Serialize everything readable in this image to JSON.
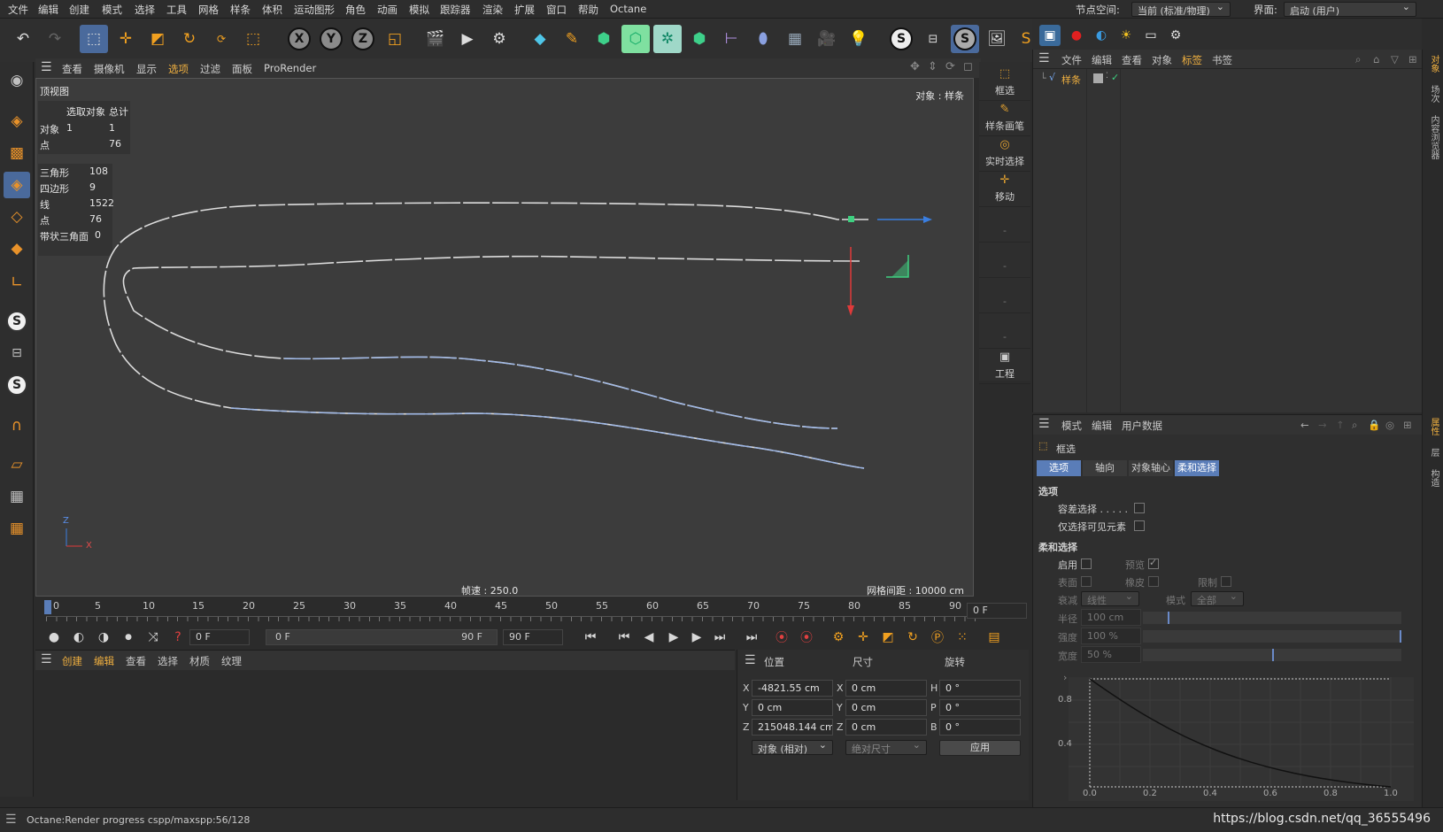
{
  "menu": [
    "文件",
    "编辑",
    "创建",
    "模式",
    "选择",
    "工具",
    "网格",
    "样条",
    "体积",
    "运动图形",
    "角色",
    "动画",
    "模拟",
    "跟踪器",
    "渲染",
    "扩展",
    "窗口",
    "帮助",
    "Octane"
  ],
  "node_space_label": "节点空间:",
  "node_space_value": "当前 (标准/物理)",
  "interface_label": "界面:",
  "interface_value": "启动 (用户)",
  "toolbar": {
    "undo": "undo-icon",
    "redo": "redo-icon",
    "x": "X",
    "y": "Y",
    "z": "Z",
    "s": "S"
  },
  "viewport_menu": [
    "查看",
    "摄像机",
    "显示",
    "选项",
    "过滤",
    "面板",
    "ProRender"
  ],
  "viewport": {
    "name": "顶视图",
    "object_label": "对象 : 样条",
    "frame_rate": "帧速 : 250.0",
    "grid_spacing": "网格间距 : 10000 cm",
    "axis_z": "Z",
    "axis_x": "X",
    "stats_header_sel": "选取对象",
    "stats_header_total": "总计",
    "stats": [
      {
        "label": "对象",
        "sel": "1",
        "total": "1"
      },
      {
        "label": "点",
        "sel": "",
        "total": "76"
      }
    ],
    "stats2": [
      {
        "label": "三角形",
        "value": "108"
      },
      {
        "label": "四边形",
        "value": "9"
      },
      {
        "label": "线",
        "value": "1522"
      },
      {
        "label": "点",
        "value": "76"
      },
      {
        "label": "带状三角面",
        "value": "0"
      }
    ]
  },
  "right_viewport_tools": [
    "框选",
    "样条画笔",
    "实时选择",
    "移动",
    "-",
    "-",
    "-",
    "-",
    "工程"
  ],
  "timeline": {
    "ticks": [
      "0",
      "5",
      "10",
      "15",
      "20",
      "25",
      "30",
      "35",
      "40",
      "45",
      "50",
      "55",
      "60",
      "65",
      "70",
      "75",
      "80",
      "85",
      "90"
    ],
    "current_frame": "0 F"
  },
  "playbar": {
    "start": "0 F",
    "range_start": "0 F",
    "range_end": "90 F",
    "end": "90 F"
  },
  "material_menu": [
    "创建",
    "编辑",
    "查看",
    "选择",
    "材质",
    "纹理"
  ],
  "coords": {
    "h_pos": "位置",
    "h_size": "尺寸",
    "h_rot": "旋转",
    "rows": [
      {
        "axis": "X",
        "pos": "-4821.55 cm",
        "saxis": "X",
        "size": "0 cm",
        "raxis": "H",
        "rot": "0 °"
      },
      {
        "axis": "Y",
        "pos": "0 cm",
        "saxis": "Y",
        "size": "0 cm",
        "raxis": "P",
        "rot": "0 °"
      },
      {
        "axis": "Z",
        "pos": "215048.144 cm",
        "saxis": "Z",
        "size": "0 cm",
        "raxis": "B",
        "rot": "0 °"
      }
    ],
    "mode": "对象 (相对)",
    "size_mode": "绝对尺寸",
    "apply": "应用"
  },
  "object_manager": {
    "menu": [
      "文件",
      "编辑",
      "查看",
      "对象",
      "标签",
      "书签"
    ],
    "object_name": "样条"
  },
  "attr_manager": {
    "menu": [
      "模式",
      "编辑",
      "用户数据"
    ],
    "tool_name": "框选",
    "tabs": [
      "选项",
      "轴向",
      "对象轴心",
      "柔和选择"
    ],
    "section_options": "选项",
    "tolerance": "容差选择 . . . . .",
    "visible_only": "仅选择可见元素",
    "section_soft": "柔和选择",
    "enable": "启用",
    "preview": "预览",
    "surface": "表面",
    "rubber": "橡皮",
    "restrict": "限制",
    "falloff_label": "衰减",
    "falloff_value": "线性",
    "mode_label": "模式",
    "mode_value": "全部",
    "radius_label": "半径",
    "radius_value": "100 cm",
    "strength_label": "强度",
    "strength_value": "100 %",
    "width_label": "宽度",
    "width_value": "50 %",
    "curve": {
      "x_ticks": [
        "0.0",
        "0.2",
        "0.4",
        "0.6",
        "0.8",
        "1.0"
      ],
      "y_ticks": [
        "0.8",
        "0.4"
      ]
    }
  },
  "right_strip": [
    "对象",
    "场次",
    "内容浏览器",
    "属性",
    "层",
    "构造"
  ],
  "status": "Octane:Render progress  cspp/maxspp:56/128",
  "watermark": "https://blog.csdn.net/qq_36555496"
}
